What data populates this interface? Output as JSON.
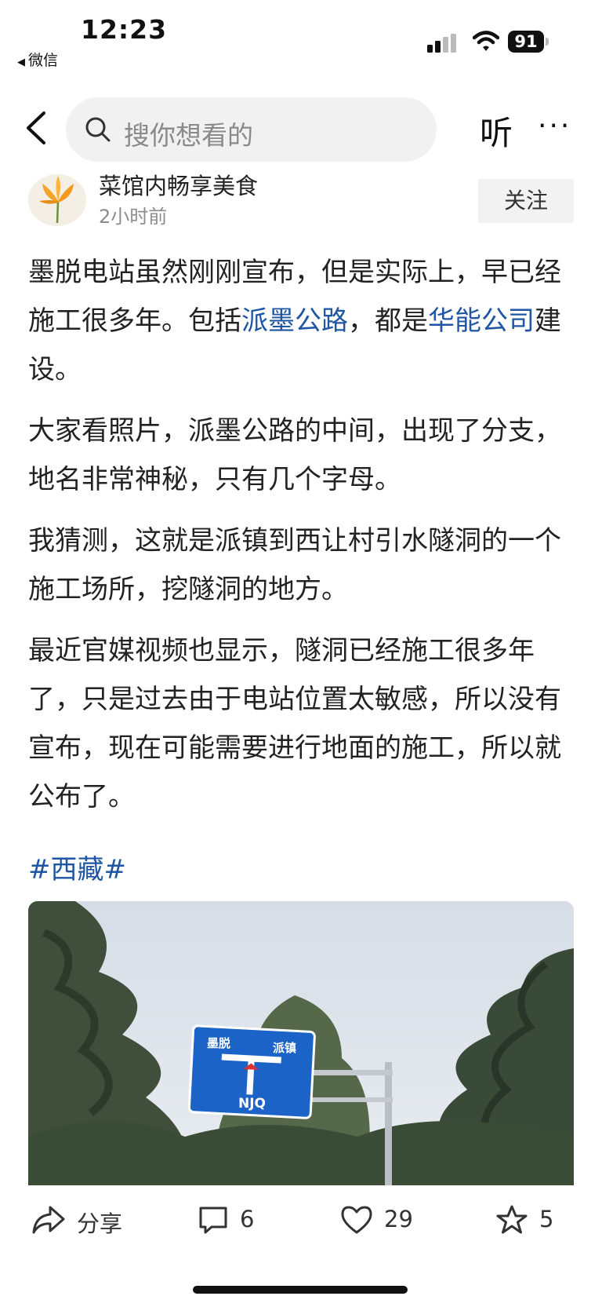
{
  "status_bar": {
    "time": "12:23",
    "back_app": "微信",
    "battery": "91"
  },
  "nav": {
    "search_placeholder": "搜你想看的",
    "listen_label": "听",
    "more_label": "···"
  },
  "author": {
    "name": "菜馆内畅享美食",
    "time": "2小时前",
    "follow_label": "关注"
  },
  "article": {
    "p1": {
      "a": "墨脱电站虽然刚刚宣布，但是实际上，早已经施工很多年。包括",
      "link1": "派墨公路",
      "b": "，都是",
      "link2": "华能公司",
      "c": "建设。"
    },
    "p2": "大家看照片，派墨公路的中间，出现了分支，地名非常神秘，只有几个字母。",
    "p3": "我猜测，这就是派镇到西让村引水隧洞的一个施工场所，挖隧洞的地方。",
    "p4": "最近官媒视频也显示，隧洞已经施工很多年了，只是过去由于电站位置太敏感，所以没有宣布，现在可能需要进行地面的施工，所以就公布了。",
    "hashtag": "#西藏#"
  },
  "photo": {
    "sign_left": "墨脱",
    "sign_right": "派镇",
    "sign_bottom": "NJQ"
  },
  "actions": {
    "share_label": "分享",
    "comments": "6",
    "likes": "29",
    "favorites": "5"
  },
  "colors": {
    "link": "#1f56a3",
    "sign_blue": "#1b63c6"
  }
}
